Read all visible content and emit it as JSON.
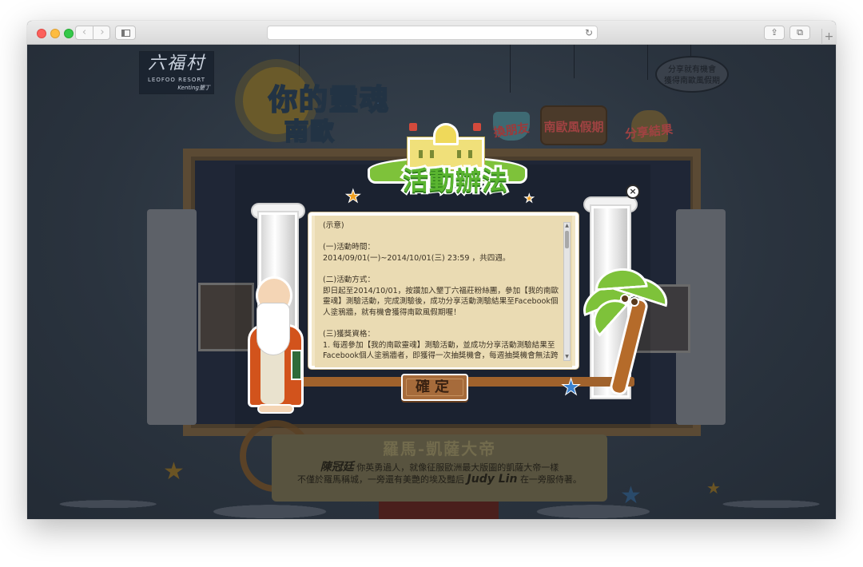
{
  "browser": {
    "back_icon": "‹",
    "forward_icon": "›",
    "reload_icon": "↻",
    "share_icon": "⇪",
    "tabs_icon": "⧉",
    "newtab_icon": "+"
  },
  "background": {
    "logo": {
      "mark": "六福村",
      "name": "LEOFOO RESORT",
      "sub": "Kenting墾丁"
    },
    "headline": {
      "line1": "你的靈魂",
      "line2": "南歐"
    },
    "nav": {
      "friends": "換朋友",
      "vacation": "南歐風假期",
      "share": "分享結果"
    },
    "bubble": {
      "line1": "分享就有機會",
      "line2": "獲得南歐風假期"
    },
    "result": {
      "title": "羅馬-凱薩大帝",
      "user_name": "陳冠廷",
      "line1_text": "你英勇過人，就像征服歐洲最大版圖的凱薩大帝一樣",
      "line2_before": "不僅於羅馬稱城，一旁還有美艷的埃及豔后",
      "friend_name": "Judy Lin",
      "line2_after": "在一旁服侍著。"
    }
  },
  "modal": {
    "title": "活動辦法",
    "close_label": "×",
    "confirm_label": "確定",
    "rules": [
      "(示意)",
      "",
      "(一)活動時間：",
      "2014/09/01(一)~2014/10/01(三) 23:59 ，共四週。",
      "",
      "(二)活動方式：",
      "即日起至2014/10/01，按讚加入墾丁六福莊粉絲團，參加【我的南歐靈魂】測驗活動，完成測驗後，成功分享活動測驗結果至Facebook個人塗鴉牆，就有機會獲得南歐風假期喔！",
      "",
      "(三)獲獎資格：",
      "1. 每週參加【我的南歐靈魂】測驗活動，並成功分享活動測驗結果至Facebook個人塗鴉牆者，即獲得一次抽獎機會，每週抽獎機會無法跨"
    ]
  }
}
